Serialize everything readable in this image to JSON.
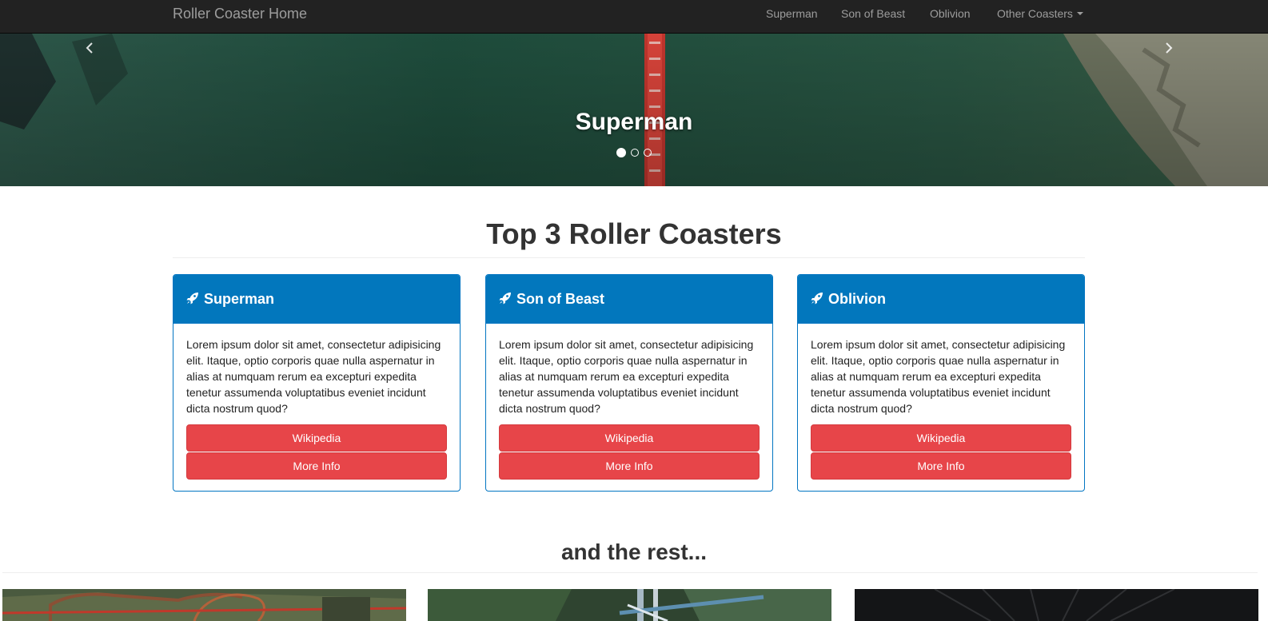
{
  "navbar": {
    "brand": "Roller Coaster Home",
    "items": [
      {
        "label": "Superman"
      },
      {
        "label": "Son of Beast"
      },
      {
        "label": "Oblivion"
      },
      {
        "label": "Other Coasters"
      }
    ]
  },
  "carousel": {
    "caption": "Superman",
    "slide_count": 3,
    "active_slide": 1,
    "prev_icon": "chevron-left-icon",
    "next_icon": "chevron-right-icon"
  },
  "top_section": {
    "title": "Top 3 Roller Coasters"
  },
  "panels": [
    {
      "title": "Superman",
      "icon": "rocket-icon",
      "body": "Lorem ipsum dolor sit amet, consectetur adipisicing elit. Itaque, optio corporis quae nulla aspernatur in alias at numquam rerum ea excepturi expedita tenetur assumenda voluptatibus eveniet incidunt dicta nostrum quod?",
      "button_1": "Wikipedia",
      "button_2": "More Info"
    },
    {
      "title": "Son of Beast",
      "icon": "rocket-icon",
      "body": "Lorem ipsum dolor sit amet, consectetur adipisicing elit. Itaque, optio corporis quae nulla aspernatur in alias at numquam rerum ea excepturi expedita tenetur assumenda voluptatibus eveniet incidunt dicta nostrum quod?",
      "button_1": "Wikipedia",
      "button_2": "More Info"
    },
    {
      "title": "Oblivion",
      "icon": "rocket-icon",
      "body": "Lorem ipsum dolor sit amet, consectetur adipisicing elit. Itaque, optio corporis quae nulla aspernatur in alias at numquam rerum ea excepturi expedita tenetur assumenda voluptatibus eveniet incidunt dicta nostrum quod?",
      "button_1": "Wikipedia",
      "button_2": "More Info"
    }
  ],
  "rest_section": {
    "title": "and the rest..."
  },
  "colors": {
    "navbar_bg": "#222222",
    "navbar_text": "#9d9d9d",
    "panel_primary": "#0277bd",
    "button_danger": "#e74549",
    "heading_text": "#333333"
  }
}
